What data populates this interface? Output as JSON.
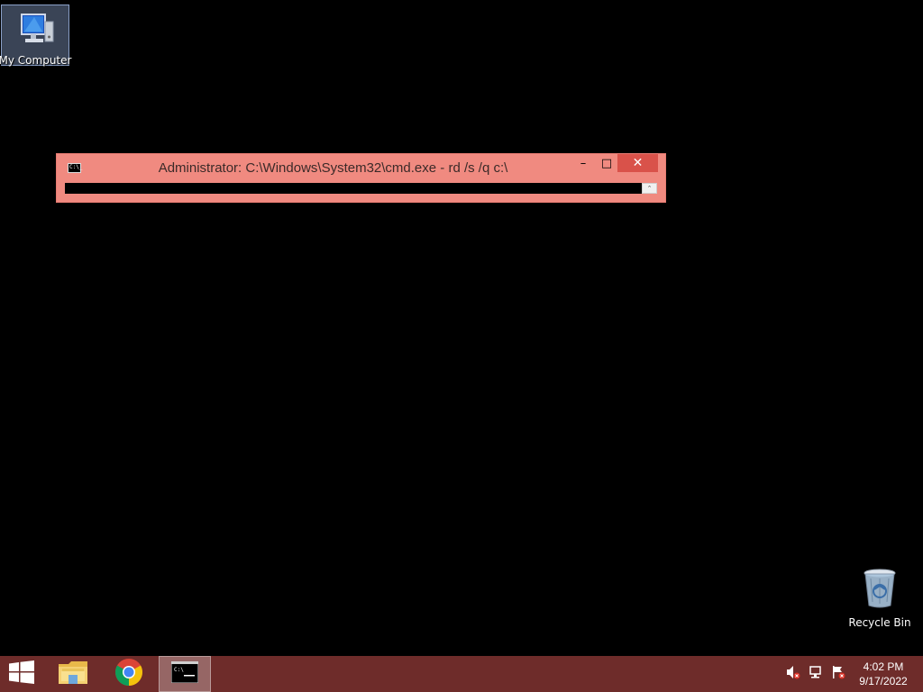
{
  "desktop": {
    "background_color": "#000000",
    "icons": [
      {
        "label": "My Computer",
        "icon": "my-computer-icon",
        "selected": true
      },
      {
        "label": "Recycle Bin",
        "icon": "recycle-bin-icon",
        "selected": false
      }
    ]
  },
  "cmd_window": {
    "title": "Administrator: C:\\Windows\\System32\\cmd.exe - rd  /s /q c:\\",
    "app_icon": "command-prompt-icon",
    "app_icon_text": "C:\\_",
    "buttons": {
      "minimize": "–",
      "maximize": "□",
      "close": "✕"
    },
    "titlebar_color": "#f08a80",
    "close_color": "#d9524a"
  },
  "taskbar": {
    "color": "#6e2c2a",
    "items": [
      {
        "name": "start",
        "icon": "windows-logo-icon"
      },
      {
        "name": "file-explorer",
        "icon": "folder-icon"
      },
      {
        "name": "chrome",
        "icon": "chrome-icon"
      },
      {
        "name": "command-prompt",
        "icon": "command-prompt-icon",
        "active": true
      }
    ],
    "tray": {
      "icons": [
        "volume-muted-icon",
        "network-icon",
        "action-center-flag-icon"
      ],
      "time": "4:02 PM",
      "date": "9/17/2022"
    }
  }
}
